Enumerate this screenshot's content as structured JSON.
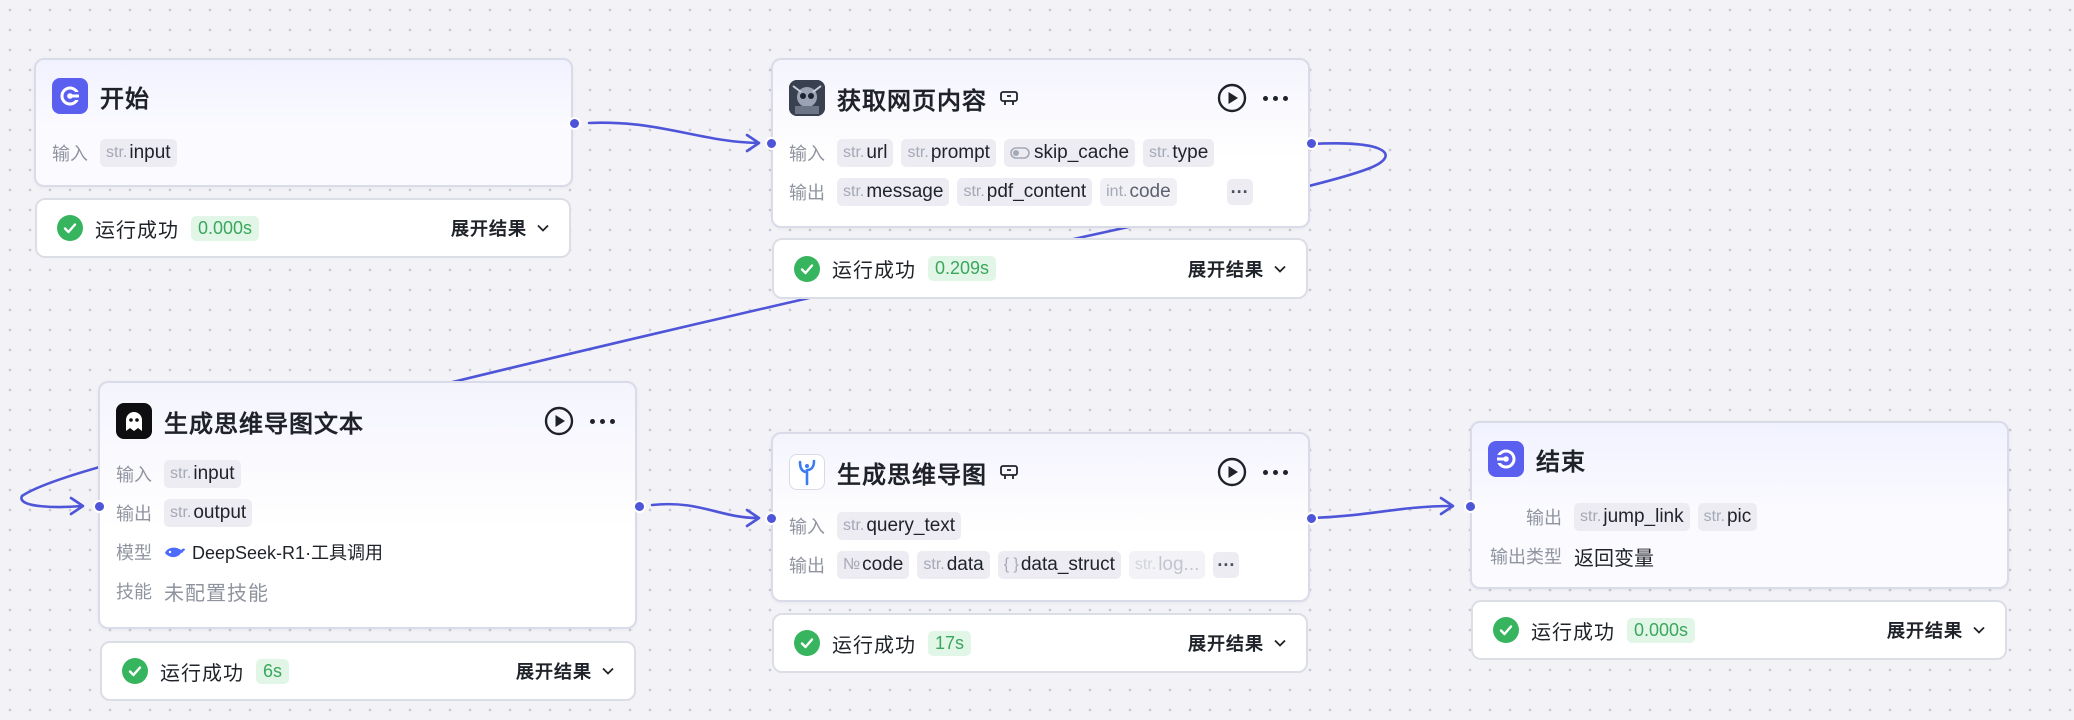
{
  "colors": {
    "accent": "#4e55d8",
    "success": "#36b55e",
    "success_text": "#3aa75c",
    "success_bg": "#e2f6e8"
  },
  "labels": {
    "input": "输入",
    "output": "输出",
    "model": "模型",
    "skills": "技能",
    "output_type": "输出类型"
  },
  "nodes": {
    "start": {
      "title": "开始",
      "icon": "start-icon",
      "inputs": [
        {
          "type": "str.",
          "name": "input"
        }
      ],
      "status": {
        "text": "运行成功",
        "time": "0.000s",
        "expand": "展开结果"
      }
    },
    "fetch": {
      "title": "获取网页内容",
      "icon": "robot-avatar-icon",
      "inputs": [
        {
          "type": "str.",
          "name": "url"
        },
        {
          "type": "str.",
          "name": "prompt"
        },
        {
          "type": "toggle",
          "name": "skip_cache"
        },
        {
          "type": "str.",
          "name": "type"
        }
      ],
      "outputs": [
        {
          "type": "str.",
          "name": "message"
        },
        {
          "type": "str.",
          "name": "pdf_content"
        },
        {
          "type": "int.",
          "name": "code"
        }
      ],
      "more": "···",
      "status": {
        "text": "运行成功",
        "time": "0.209s",
        "expand": "展开结果"
      }
    },
    "mindtext": {
      "title": "生成思维导图文本",
      "icon": "ghost-icon",
      "inputs": [
        {
          "type": "str.",
          "name": "input"
        }
      ],
      "outputs": [
        {
          "type": "str.",
          "name": "output"
        }
      ],
      "model": "DeepSeek-R1·工具调用",
      "skills": "未配置技能",
      "status": {
        "text": "运行成功",
        "time": "6s",
        "expand": "展开结果"
      }
    },
    "mindmap": {
      "title": "生成思维导图",
      "icon": "mindmap-icon",
      "inputs": [
        {
          "type": "str.",
          "name": "query_text"
        }
      ],
      "outputs": [
        {
          "type": "№",
          "name": "code"
        },
        {
          "type": "str.",
          "name": "data"
        },
        {
          "type": "{ }",
          "name": "data_struct"
        },
        {
          "type": "str.",
          "name": "log..."
        }
      ],
      "more": "···",
      "status": {
        "text": "运行成功",
        "time": "17s",
        "expand": "展开结果"
      }
    },
    "end": {
      "title": "结束",
      "icon": "end-icon",
      "outputs": [
        {
          "type": "str.",
          "name": "jump_link"
        },
        {
          "type": "str.",
          "name": "pic"
        }
      ],
      "output_type": "返回变量",
      "status": {
        "text": "运行成功",
        "time": "0.000s",
        "expand": "展开结果"
      }
    }
  }
}
